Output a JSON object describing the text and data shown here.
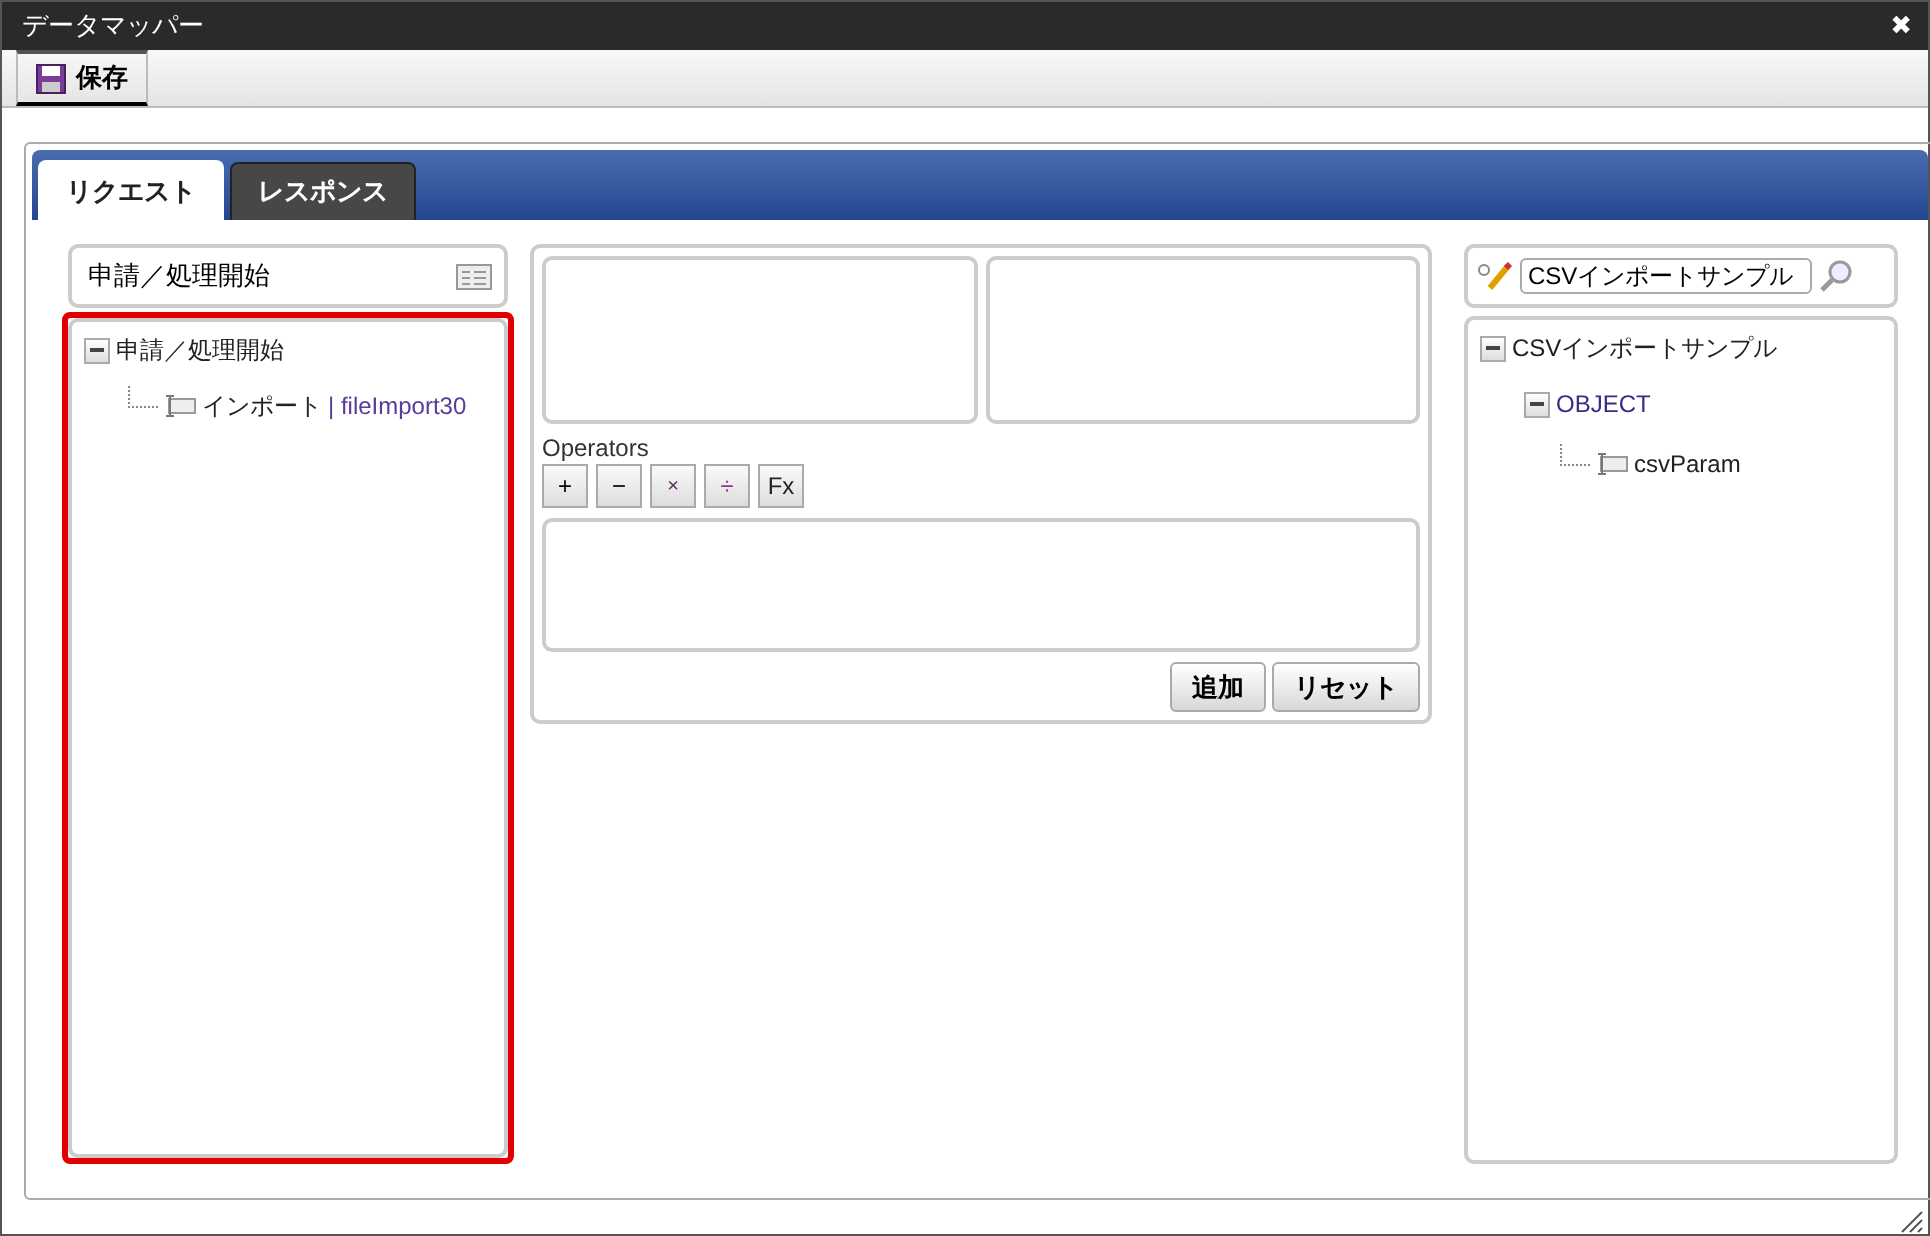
{
  "window": {
    "title": "データマッパー",
    "close": "✖"
  },
  "toolbar": {
    "buttons": [
      {
        "label": "保存",
        "kind": "save"
      }
    ]
  },
  "tabs": [
    {
      "label": "リクエスト",
      "selected": true
    },
    {
      "label": "レスポンス",
      "selected": false
    }
  ],
  "source": {
    "header": "申請／処理開始",
    "highlighted": true,
    "tree": [
      {
        "label": "申請／処理開始",
        "kind": "folder",
        "expanded": true,
        "children": [
          {
            "label": "インポート",
            "sublabel": "| fileImport30",
            "kind": "field"
          }
        ]
      }
    ]
  },
  "editor": {
    "operators_label": "Operators",
    "operators": [
      "+",
      "−",
      "×",
      "÷",
      "Fx"
    ],
    "buttons": [
      "追加",
      "リセット"
    ]
  },
  "target": {
    "search": {
      "value": "CSVインポートサンプル"
    },
    "tree": [
      {
        "label": "CSVインポートサンプル",
        "kind": "folder",
        "expanded": true,
        "children": [
          {
            "label": "OBJECT",
            "kind": "folder",
            "expanded": true,
            "accent": true,
            "children": [
              {
                "label": "csvParam",
                "kind": "field"
              }
            ]
          }
        ]
      }
    ]
  }
}
